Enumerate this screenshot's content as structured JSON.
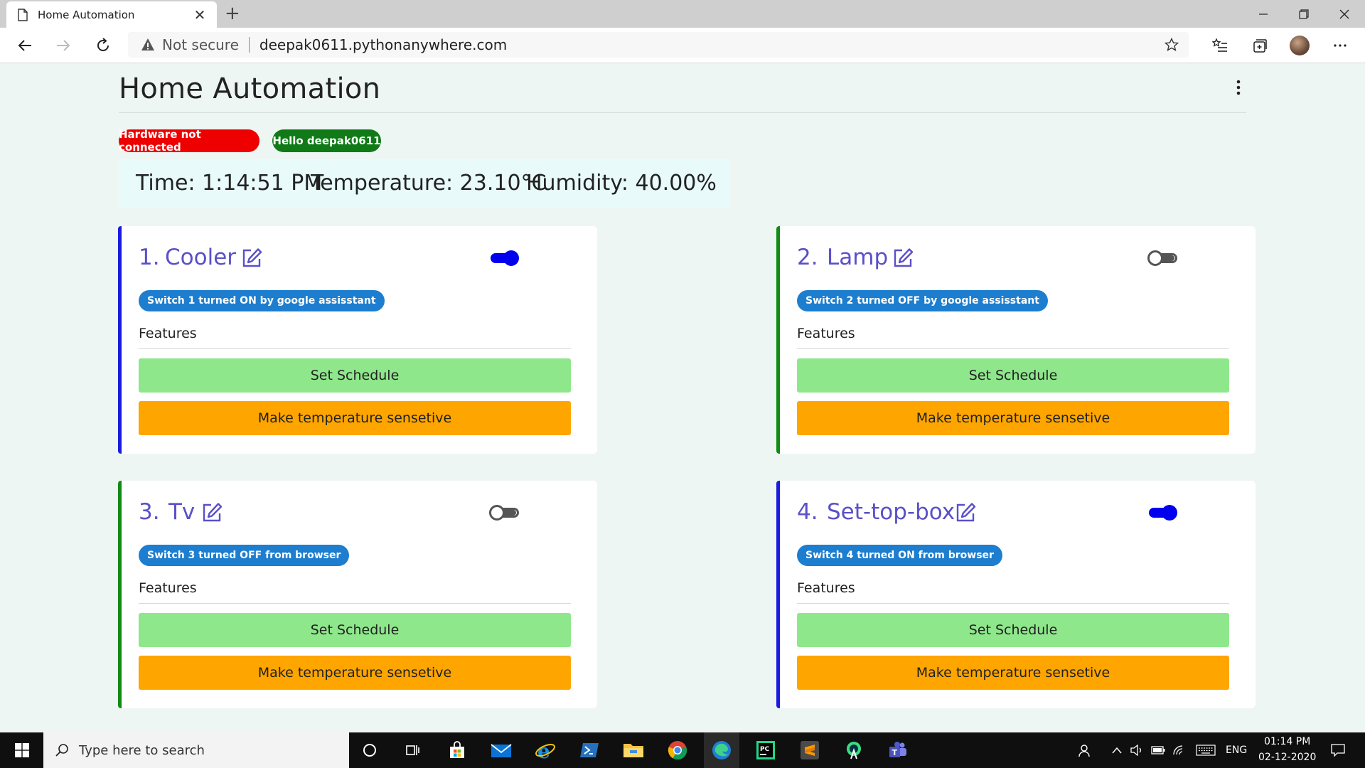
{
  "browser": {
    "tab_title": "Home Automation",
    "not_secure_label": "Not secure",
    "url": "deepak0611.pythonanywhere.com"
  },
  "page": {
    "title": "Home Automation",
    "badges": {
      "hardware": "Hardware not connected",
      "greeting": "Hello deepak0611"
    },
    "info": {
      "time": "Time: 1:14:51 PM",
      "temperature": "Temperature: 23.10°C",
      "humidity": "Humidity: 40.00%"
    }
  },
  "devices": [
    {
      "num": "1.",
      "name": "Cooler",
      "on": true,
      "status": "Switch 1 turned ON by google assisstant",
      "features_label": "Features",
      "schedule_label": "Set Schedule",
      "temp_label": "Make temperature sensetive",
      "accent": "#1a1ae0"
    },
    {
      "num": "2.",
      "name": "Lamp",
      "on": false,
      "status": "Switch 2 turned OFF by google assisstant",
      "features_label": "Features",
      "schedule_label": "Set Schedule",
      "temp_label": "Make temperature sensetive",
      "accent": "#138a13"
    },
    {
      "num": "3.",
      "name": "Tv",
      "on": false,
      "status": "Switch 3 turned OFF from browser",
      "features_label": "Features",
      "schedule_label": "Set Schedule",
      "temp_label": "Make temperature sensetive",
      "accent": "#138a13"
    },
    {
      "num": "4.",
      "name": "Set-top-box",
      "on": true,
      "status": "Switch 4 turned ON from browser",
      "features_label": "Features",
      "schedule_label": "Set Schedule",
      "temp_label": "Make temperature sensetive",
      "accent": "#1a1ae0"
    }
  ],
  "taskbar": {
    "search_placeholder": "Type here to search",
    "language": "ENG",
    "time": "01:14 PM",
    "date": "02-12-2020"
  },
  "colors": {
    "device_title": "#5a50c8",
    "toggle_on": "#0000ee",
    "schedule_button": "#8fe78b",
    "temperature_button": "#ffa500",
    "status_badge": "#1d7ecf",
    "hardware_badge": "#ee0000",
    "greeting_badge": "#0f7a16"
  }
}
